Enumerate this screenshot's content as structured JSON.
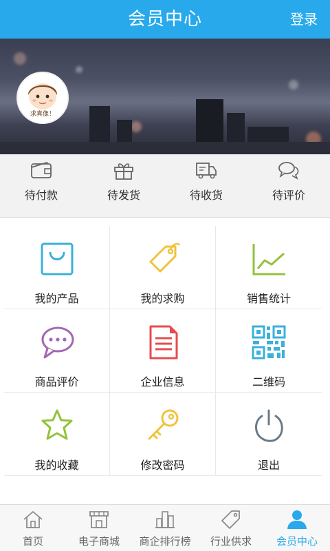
{
  "header": {
    "title": "会员中心",
    "login_label": "登录"
  },
  "profile": {
    "avatar_caption": "求真像！"
  },
  "orders": [
    {
      "label": "待付款",
      "icon": "wallet-icon"
    },
    {
      "label": "待发货",
      "icon": "gift-icon"
    },
    {
      "label": "待收货",
      "icon": "truck-icon"
    },
    {
      "label": "待评价",
      "icon": "chat-bubbles-icon"
    }
  ],
  "menu": [
    {
      "label": "我的产品",
      "icon": "shopping-bag-icon",
      "color": "#3bb0d8"
    },
    {
      "label": "我的求购",
      "icon": "price-tag-icon",
      "color": "#f0c33c"
    },
    {
      "label": "销售统计",
      "icon": "line-chart-icon",
      "color": "#93c23c"
    },
    {
      "label": "商品评价",
      "icon": "chat-bubble-icon",
      "color": "#a367b5"
    },
    {
      "label": "企业信息",
      "icon": "document-icon",
      "color": "#e74c4c"
    },
    {
      "label": "二维码",
      "icon": "qr-code-icon",
      "color": "#3bb0d8"
    },
    {
      "label": "我的收藏",
      "icon": "star-icon",
      "color": "#93c23c"
    },
    {
      "label": "修改密码",
      "icon": "key-icon",
      "color": "#f0c33c"
    },
    {
      "label": "退出",
      "icon": "power-icon",
      "color": "#6b7a86"
    }
  ],
  "tabs": [
    {
      "label": "首页",
      "icon": "home-icon"
    },
    {
      "label": "电子商城",
      "icon": "store-icon"
    },
    {
      "label": "商企排行榜",
      "icon": "buildings-icon"
    },
    {
      "label": "行业供求",
      "icon": "tag-icon"
    },
    {
      "label": "会员中心",
      "icon": "user-icon",
      "active": true
    }
  ],
  "colors": {
    "accent": "#27a9ec",
    "order_bar_bg": "#f2f2f2",
    "icon_gray": "#8a8a8a"
  }
}
